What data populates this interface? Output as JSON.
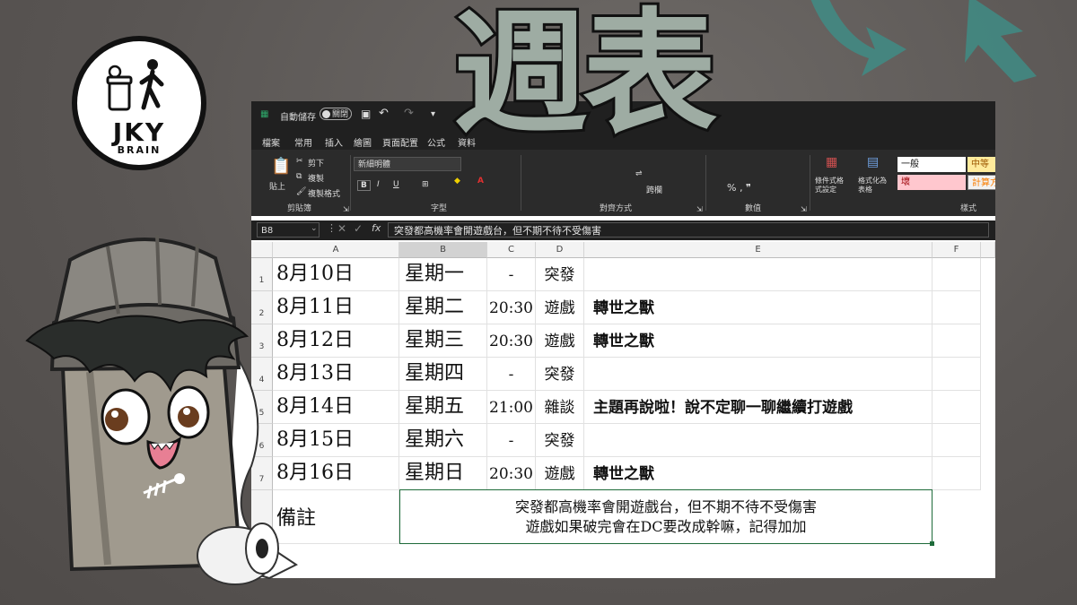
{
  "title": "週表",
  "logo": {
    "text": "JKY",
    "sub": "BRAIN"
  },
  "excel": {
    "titlebar": {
      "autosave": "自動儲存",
      "toggle": "關閉"
    },
    "tabs": [
      "檔案",
      "常用",
      "插入",
      "繪圖",
      "頁面配置",
      "公式",
      "資料"
    ],
    "clipboard": {
      "cut": "剪下",
      "copy": "複製",
      "format_painter": "複製格式",
      "paste": "貼上",
      "label": "剪貼簿"
    },
    "font": {
      "name": "新細明體",
      "label": "字型"
    },
    "alignment": {
      "wrap": "跨欄",
      "label": "對齊方式"
    },
    "number": {
      "label": "數值"
    },
    "styles": {
      "cond_format": "條件式格式設定",
      "format_table": "格式化為表格",
      "general": "一般",
      "medium": "中等",
      "bad": "壞",
      "calc": "計算方",
      "label": "樣式"
    },
    "namebox": "B8",
    "formula": "突發都高機率會開遊戲台，但不期不待不受傷害",
    "columns": [
      "A",
      "B",
      "C",
      "D",
      "E",
      "F"
    ],
    "rows": [
      {
        "num": "1",
        "date": "8月10日",
        "weekday": "星期一",
        "time": "-",
        "type": "突發",
        "name": ""
      },
      {
        "num": "2",
        "date": "8月11日",
        "weekday": "星期二",
        "time": "20:30",
        "type": "遊戲",
        "name": "轉世之獸"
      },
      {
        "num": "3",
        "date": "8月12日",
        "weekday": "星期三",
        "time": "20:30",
        "type": "遊戲",
        "name": "轉世之獸"
      },
      {
        "num": "4",
        "date": "8月13日",
        "weekday": "星期四",
        "time": "-",
        "type": "突發",
        "name": ""
      },
      {
        "num": "5",
        "date": "8月14日",
        "weekday": "星期五",
        "time": "21:00",
        "type": "雜談",
        "name": "主題再說啦！說不定聊一聊繼續打遊戲"
      },
      {
        "num": "6",
        "date": "8月15日",
        "weekday": "星期六",
        "time": "-",
        "type": "突發",
        "name": ""
      },
      {
        "num": "7",
        "date": "8月16日",
        "weekday": "星期日",
        "time": "20:30",
        "type": "遊戲",
        "name": "轉世之獸"
      }
    ],
    "remark_label": "備註",
    "remark_lines": [
      "突發都高機率會開遊戲台，但不期不待不受傷害",
      "遊戲如果破完會在DC要改成幹嘛，記得加加"
    ]
  }
}
